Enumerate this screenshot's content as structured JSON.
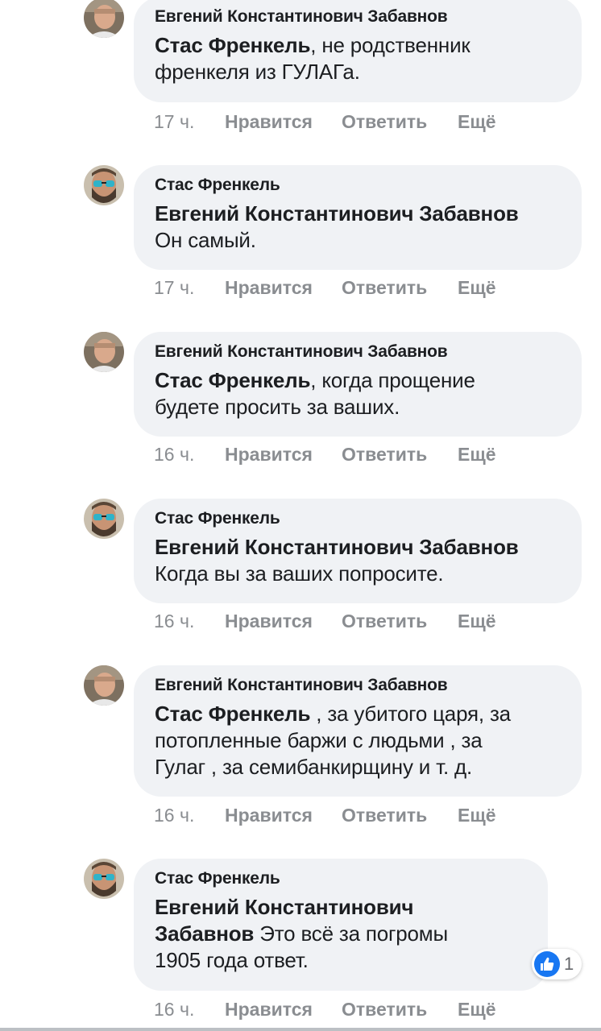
{
  "comments": [
    {
      "author": "Евгений Константинович Забавнов",
      "avatar": "zabavnov-avatar",
      "mention": "Стас Френкель",
      "line1_rest": ", не родственник",
      "line2": "френкеля из ГУЛАГа.",
      "time": "17 ч.",
      "like": "Нравится",
      "reply": "Ответить",
      "more": "Ещё"
    },
    {
      "author": "Стас Френкель",
      "avatar": "frenkel-avatar",
      "mention": "Евгений Константинович Забавнов",
      "line2": "Он самый.",
      "time": "17 ч.",
      "like": "Нравится",
      "reply": "Ответить",
      "more": "Ещё"
    },
    {
      "author": "Евгений Константинович Забавнов",
      "avatar": "zabavnov-avatar",
      "mention": "Стас Френкель",
      "line1_rest": ", когда прощение",
      "line2": "будете просить за ваших.",
      "time": "16 ч.",
      "like": "Нравится",
      "reply": "Ответить",
      "more": "Ещё"
    },
    {
      "author": "Стас Френкель",
      "avatar": "frenkel-avatar",
      "mention": "Евгений Константинович Забавнов",
      "line2": "Когда вы за ваших попросите.",
      "time": "16 ч.",
      "like": "Нравится",
      "reply": "Ответить",
      "more": "Ещё"
    },
    {
      "author": "Евгений Константинович Забавнов",
      "avatar": "zabavnov-avatar",
      "mention": "Стас Френкель",
      "line1_rest": " , за убитого царя, за",
      "line2": "потопленные баржи с людьми , за",
      "line3": "Гулаг , за семибанкирщину и т. д.",
      "time": "16 ч.",
      "like": "Нравится",
      "reply": "Ответить",
      "more": "Ещё"
    },
    {
      "author": "Стас Френкель",
      "avatar": "frenkel-avatar",
      "mention_line1": "Евгений Константинович",
      "mention_line2": "Забавнов",
      "line2_rest": " Это всё за погромы",
      "line3": "1905 года ответ.",
      "time": "16 ч.",
      "like": "Нравится",
      "reply": "Ответить",
      "more": "Ещё",
      "reactions": {
        "icon": "thumbs-up-icon",
        "count": "1"
      }
    }
  ],
  "colors": {
    "bubble": "#f0f2f5",
    "text": "#1c1e21",
    "meta": "#8a8d91",
    "like_blue": "#1877f2"
  }
}
